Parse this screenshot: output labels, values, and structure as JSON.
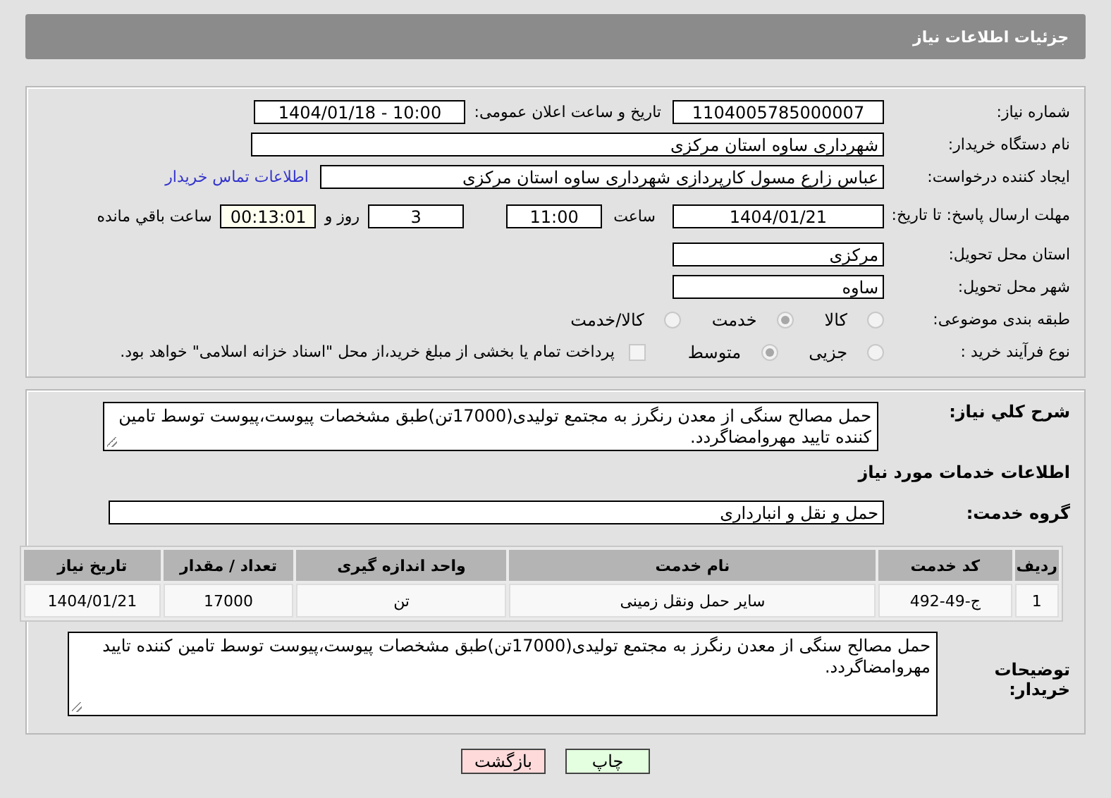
{
  "header": {
    "title": "جزئیات اطلاعات نیاز"
  },
  "need_number": {
    "label": "شماره نیاز:",
    "value": "1104005785000007"
  },
  "announce": {
    "label": "تاریخ و ساعت اعلان عمومی:",
    "value": "1404/01/18 - 10:00"
  },
  "buyer": {
    "label": "نام دستگاه خریدار:",
    "value": "شهرداری ساوه استان مرکزی"
  },
  "creator": {
    "label": "ایجاد کننده درخواست:",
    "value": "عباس زارع مسول کارپردازی شهرداری ساوه استان مرکزی",
    "link": "اطلاعات تماس خریدار"
  },
  "deadline": {
    "label": "مهلت ارسال پاسخ: تا تاریخ:",
    "date": "1404/01/21",
    "time_label": "ساعت",
    "time": "11:00",
    "days": "3",
    "days_label": "روز و",
    "remaining": "00:13:01",
    "remaining_label": "ساعت باقي مانده"
  },
  "province": {
    "label": "استان محل تحویل:",
    "value": "مرکزی"
  },
  "city": {
    "label": "شهر محل تحویل:",
    "value": "ساوه"
  },
  "category": {
    "label": "طبقه بندی موضوعی:",
    "options": [
      {
        "label": "کالا",
        "selected": false
      },
      {
        "label": "خدمت",
        "selected": true
      },
      {
        "label": "کالا/خدمت",
        "selected": false
      }
    ]
  },
  "process": {
    "label": "نوع فرآیند خرید :",
    "options": [
      {
        "label": "جزیی",
        "selected": false
      },
      {
        "label": "متوسط",
        "selected": true
      }
    ],
    "payment": {
      "checked": false,
      "text": "پرداخت تمام یا بخشی از مبلغ خرید،از محل \"اسناد خزانه اسلامی\" خواهد بود."
    }
  },
  "description": {
    "label": "شرح کلي نیاز:",
    "value": "حمل مصالح سنگی از معدن رنگرز به مجتمع تولیدی(17000تن)طبق مشخصات پیوست،پیوست توسط تامین کننده تایید مهروامضاگردد."
  },
  "services_heading": "اطلاعات خدمات مورد نیاز",
  "service_group": {
    "label": "گروه خدمت:",
    "value": "حمل و نقل و انبارداری"
  },
  "table": {
    "columns": [
      "ردیف",
      "کد خدمت",
      "نام خدمت",
      "واحد اندازه گیری",
      "تعداد / مقدار",
      "تاریخ نیاز"
    ],
    "rows": [
      [
        "1",
        "ج-49-492",
        "سایر حمل ونقل زمینی",
        "تن",
        "17000",
        "1404/01/21"
      ]
    ]
  },
  "buyer_notes": {
    "label": "توضیحات خریدار:",
    "value": "حمل مصالح سنگی از معدن رنگرز به مجتمع تولیدی(17000تن)طبق مشخصات پیوست،پیوست توسط تامین کننده تایید مهروامضاگردد."
  },
  "buttons": [
    {
      "label": "چاپ",
      "kind": "print"
    },
    {
      "label": "بازگشت",
      "kind": "back"
    }
  ]
}
